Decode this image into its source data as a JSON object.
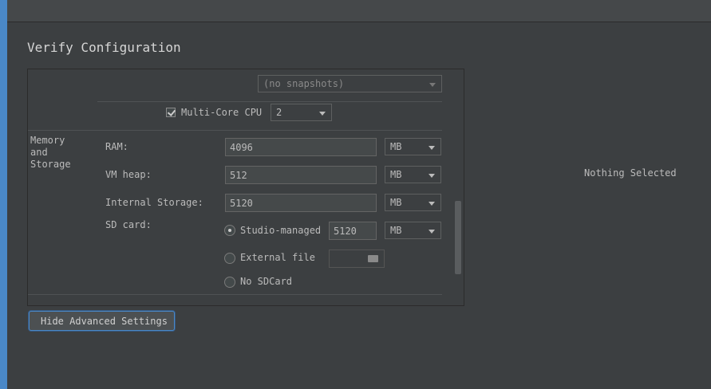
{
  "title": "Verify Configuration",
  "snapshot": {
    "value": "(no snapshots)"
  },
  "multicore": {
    "label": "Multi-Core CPU",
    "checked": true,
    "value": "2"
  },
  "memory": {
    "section_label_line1": "Memory",
    "section_label_line2": "and",
    "section_label_line3": "Storage",
    "ram": {
      "label": "RAM:",
      "value": "4096",
      "unit": "MB"
    },
    "vm_heap": {
      "label": "VM heap:",
      "value": "512",
      "unit": "MB"
    },
    "internal_storage": {
      "label": "Internal Storage:",
      "value": "5120",
      "unit": "MB"
    },
    "sd_card": {
      "label": "SD card:",
      "studio_managed": {
        "label": "Studio-managed",
        "value": "5120",
        "unit": "MB",
        "selected": true
      },
      "external_file": {
        "label": "External file",
        "value": "",
        "selected": false
      },
      "no_sdcard": {
        "label": "No SDCard",
        "selected": false
      }
    }
  },
  "hide_advanced_button": "Hide Advanced Settings",
  "details_panel": {
    "empty_text": "Nothing Selected"
  },
  "colors": {
    "background": "#3c3f41",
    "accent": "#4a88c7",
    "text": "#bbbbbb"
  }
}
